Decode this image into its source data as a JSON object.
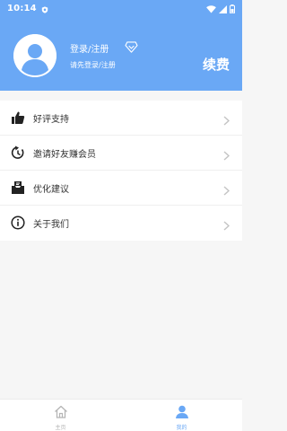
{
  "status_bar": {
    "time": "10:14"
  },
  "profile": {
    "login_title": "登录/注册",
    "login_subtitle": "请先登录/注册",
    "renew_label": "续费"
  },
  "menu": {
    "items": [
      {
        "label": "好评支持",
        "icon": "thumbs-up-icon"
      },
      {
        "label": "邀请好友赚会员",
        "icon": "refresh-arrow-icon"
      },
      {
        "label": "优化建议",
        "icon": "mailbox-icon"
      },
      {
        "label": "关于我们",
        "icon": "info-icon"
      }
    ]
  },
  "tabbar": {
    "tabs": [
      {
        "label": "主页",
        "icon": "home-icon",
        "active": false
      },
      {
        "label": "我的",
        "icon": "person-icon",
        "active": true
      }
    ]
  },
  "colors": {
    "accent": "#6aa8f5",
    "background": "#f6f6f6",
    "text": "#333333",
    "inactive": "#b5b5b5"
  }
}
